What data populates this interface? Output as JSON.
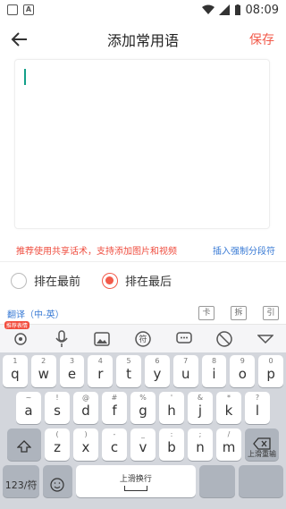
{
  "status": {
    "time": "08:09",
    "left_icon_label": "A"
  },
  "header": {
    "title": "添加常用语",
    "save_label": "保存"
  },
  "hints": {
    "left": "推荐使用共享话术，支持添加图片和视频",
    "right": "插入强制分段符"
  },
  "options": {
    "first": "排在最前",
    "last": "排在最后",
    "selected": "last"
  },
  "translate": {
    "label": "翻译（中-英）",
    "boxes": [
      "卡",
      "拆",
      "引"
    ]
  },
  "toolbar": {
    "badge": "推荐表情",
    "symbol_label": "符"
  },
  "keyboard": {
    "row1": [
      {
        "k": "q",
        "s": "1"
      },
      {
        "k": "w",
        "s": "2"
      },
      {
        "k": "e",
        "s": "3"
      },
      {
        "k": "r",
        "s": "4"
      },
      {
        "k": "t",
        "s": "5"
      },
      {
        "k": "y",
        "s": "6"
      },
      {
        "k": "u",
        "s": "7"
      },
      {
        "k": "i",
        "s": "8"
      },
      {
        "k": "o",
        "s": "9"
      },
      {
        "k": "p",
        "s": "0"
      }
    ],
    "row2": [
      {
        "k": "a",
        "s": "~"
      },
      {
        "k": "s",
        "s": "!"
      },
      {
        "k": "d",
        "s": "@"
      },
      {
        "k": "f",
        "s": "#"
      },
      {
        "k": "g",
        "s": "%"
      },
      {
        "k": "h",
        "s": "'"
      },
      {
        "k": "j",
        "s": "&"
      },
      {
        "k": "k",
        "s": "*"
      },
      {
        "k": "l",
        "s": "?"
      }
    ],
    "row3": [
      {
        "k": "z",
        "s": "("
      },
      {
        "k": "x",
        "s": ")"
      },
      {
        "k": "c",
        "s": "-"
      },
      {
        "k": "v",
        "s": "_"
      },
      {
        "k": "b",
        "s": ":"
      },
      {
        "k": "n",
        "s": ";"
      },
      {
        "k": "m",
        "s": "/"
      }
    ],
    "numkey": "123/符",
    "space": "上滑换行",
    "delete_hint": "上滑重输",
    "enter_label": ""
  }
}
